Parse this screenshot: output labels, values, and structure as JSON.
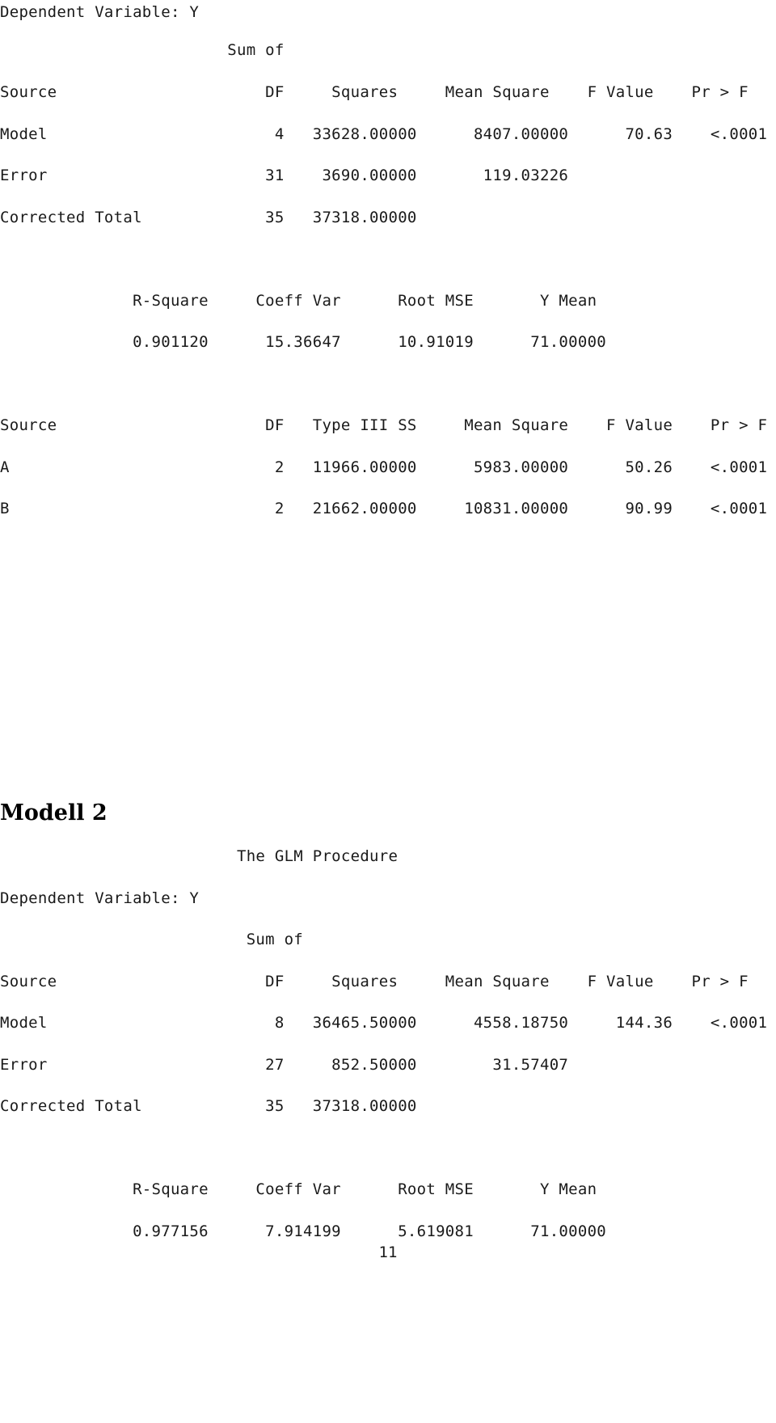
{
  "document": {
    "page_number": "11",
    "text_color": "#1a1a1a",
    "background_color": "#ffffff"
  },
  "model1": {
    "dependent_variable_line": "Dependent Variable: Y",
    "anova": {
      "sum_of_label": "                        Sum of",
      "header": "Source                      DF     Squares     Mean Square    F Value    Pr > F",
      "rows": [
        "Model                        4   33628.00000      8407.00000      70.63    <.0001",
        "Error                       31    3690.00000       119.03226",
        "Corrected Total             35   37318.00000"
      ]
    },
    "fit": {
      "header": "              R-Square     Coeff Var      Root MSE       Y Mean",
      "values": "              0.901120      15.36647      10.91019      71.00000"
    },
    "type3": {
      "header": "Source                      DF   Type III SS     Mean Square    F Value    Pr > F",
      "rows": [
        "A                            2   11966.00000      5983.00000      50.26    <.0001",
        "B                            2   21662.00000     10831.00000      90.99    <.0001"
      ]
    }
  },
  "model2": {
    "heading": "Modell 2",
    "procedure_title": "                         The GLM Procedure",
    "dependent_variable_line": "Dependent Variable: Y",
    "anova": {
      "sum_of_label": "                          Sum of",
      "header": "Source                      DF     Squares     Mean Square    F Value    Pr > F",
      "rows": [
        "Model                        8   36465.50000      4558.18750     144.36    <.0001",
        "Error                       27     852.50000        31.57407",
        "Corrected Total             35   37318.00000"
      ]
    },
    "fit": {
      "header": "              R-Square     Coeff Var      Root MSE       Y Mean",
      "values": "              0.977156      7.914199      5.619081      71.00000"
    }
  },
  "tables_structured": {
    "model1_anova": {
      "columns": [
        "Source",
        "DF",
        "Sum of Squares",
        "Mean Square",
        "F Value",
        "Pr > F"
      ],
      "rows": [
        [
          "Model",
          "4",
          "33628.00000",
          "8407.00000",
          "70.63",
          "<.0001"
        ],
        [
          "Error",
          "31",
          "3690.00000",
          "119.03226",
          "",
          ""
        ],
        [
          "Corrected Total",
          "35",
          "37318.00000",
          "",
          "",
          ""
        ]
      ]
    },
    "model1_fit": {
      "columns": [
        "R-Square",
        "Coeff Var",
        "Root MSE",
        "Y Mean"
      ],
      "rows": [
        [
          "0.901120",
          "15.36647",
          "10.91019",
          "71.00000"
        ]
      ]
    },
    "model1_type3": {
      "columns": [
        "Source",
        "DF",
        "Type III SS",
        "Mean Square",
        "F Value",
        "Pr > F"
      ],
      "rows": [
        [
          "A",
          "2",
          "11966.00000",
          "5983.00000",
          "50.26",
          "<.0001"
        ],
        [
          "B",
          "2",
          "21662.00000",
          "10831.00000",
          "90.99",
          "<.0001"
        ]
      ]
    },
    "model2_anova": {
      "columns": [
        "Source",
        "DF",
        "Sum of Squares",
        "Mean Square",
        "F Value",
        "Pr > F"
      ],
      "rows": [
        [
          "Model",
          "8",
          "36465.50000",
          "4558.18750",
          "144.36",
          "<.0001"
        ],
        [
          "Error",
          "27",
          "852.50000",
          "31.57407",
          "",
          ""
        ],
        [
          "Corrected Total",
          "35",
          "37318.00000",
          "",
          "",
          ""
        ]
      ]
    },
    "model2_fit": {
      "columns": [
        "R-Square",
        "Coeff Var",
        "Root MSE",
        "Y Mean"
      ],
      "rows": [
        [
          "0.977156",
          "7.914199",
          "5.619081",
          "71.00000"
        ]
      ]
    }
  }
}
